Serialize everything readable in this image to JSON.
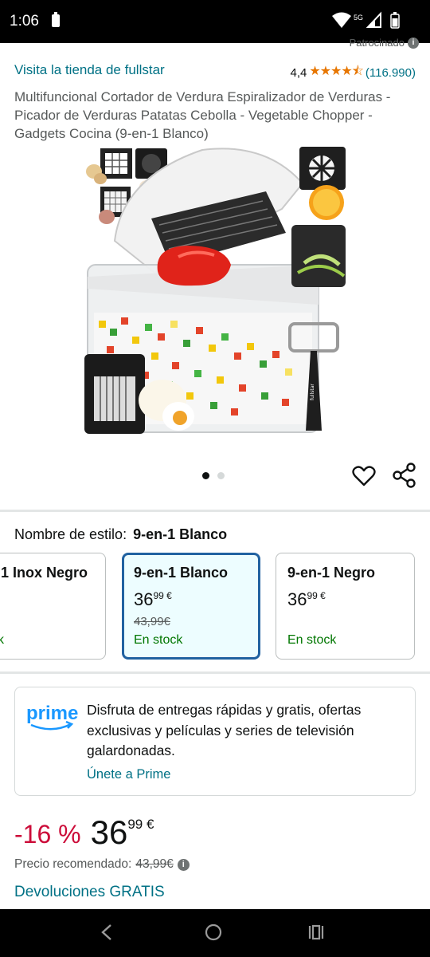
{
  "status_bar": {
    "time": "1:06",
    "network": "5G"
  },
  "sponsored": {
    "label": "Patrocinado",
    "info": "i"
  },
  "store": {
    "link": "Visita la tienda de fullstar"
  },
  "rating": {
    "value": "4,4",
    "stars": "★★★★⯪",
    "count": "(116.990)",
    "star_fraction": 0.88
  },
  "product": {
    "title": "Multifuncional Cortador de Verdura Espiralizador de Verduras - Picador de Verduras Patatas Cebolla - Vegetable Chopper - Gadgets Cocina (9-en-1 Blanco)",
    "image_count": 2,
    "active_image": 1,
    "brand_mark": "fullstar"
  },
  "style": {
    "label": "Nombre de estilo:",
    "selected": "9-en-1 Blanco",
    "options": [
      {
        "name": "1 Inox Negro",
        "price_int": "",
        "price_dec": "",
        "old_price": "",
        "stock": "ck"
      },
      {
        "name": "9-en-1 Blanco",
        "price_int": "36",
        "price_dec": "99 €",
        "old_price": "43,99€",
        "stock": "En stock"
      },
      {
        "name": "9-en-1 Negro",
        "price_int": "36",
        "price_dec": "99 €",
        "old_price": "",
        "stock": "En stock"
      }
    ]
  },
  "prime": {
    "logo_text": "prime",
    "description": "Disfruta de entregas rápidas y gratis, ofertas exclusivas y películas y series de televisión galardonadas.",
    "join_link": "Únete a Prime"
  },
  "price": {
    "discount": "-16 %",
    "integer": "36",
    "decimal": "99 €",
    "rrp_label": "Precio recomendado:",
    "rrp_value": "43,99€",
    "info": "i"
  },
  "returns": {
    "label": "Devoluciones GRATIS"
  },
  "colors": {
    "link": "#007185",
    "star": "#e77600",
    "discount": "#cc0c39",
    "stock": "#007600",
    "selected_border": "#2162a1"
  },
  "icons": [
    "wifi-icon",
    "signal-icon",
    "battery-icon",
    "heart-icon",
    "share-icon",
    "back-icon",
    "home-icon",
    "recents-icon"
  ]
}
